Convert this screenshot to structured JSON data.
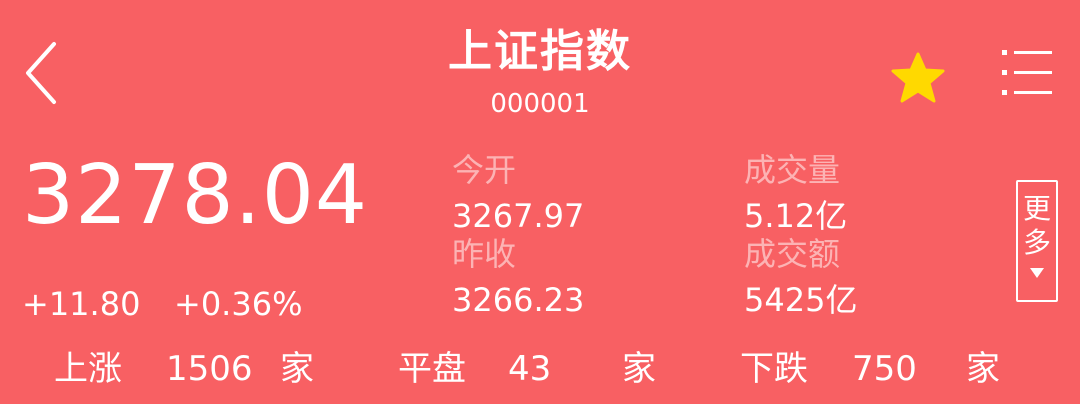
{
  "header": {
    "title": "上证指数",
    "code": "000001",
    "icons": [
      "back-icon",
      "star-icon",
      "menu-list-icon"
    ],
    "star_color": "#ffd900"
  },
  "quote": {
    "price": "3278.04",
    "change": "+11.80",
    "change_pct": "+0.36%"
  },
  "stats": {
    "open_label": "今开",
    "open_value": "3267.97",
    "prev_close_label": "昨收",
    "prev_close_value": "3266.23",
    "volume_label": "成交量",
    "volume_value": "5.12亿",
    "turnover_label": "成交额",
    "turnover_value": "5425亿"
  },
  "more": {
    "label": "更多"
  },
  "breadth": {
    "up_label": "上涨",
    "up_count": "1506",
    "up_unit": "家",
    "flat_label": "平盘",
    "flat_count": "43",
    "flat_unit": "家",
    "down_label": "下跌",
    "down_count": "750",
    "down_unit": "家"
  },
  "colors": {
    "background": "#f86063",
    "text": "#ffffff",
    "label_muted": "#fcb3b4"
  }
}
